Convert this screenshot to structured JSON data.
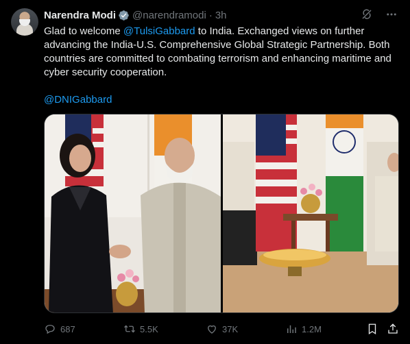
{
  "post": {
    "author_name": "Narendra Modi",
    "handle": "@narendramodi",
    "separator": "·",
    "time": "3h",
    "text_before": "Glad to welcome ",
    "mention": "@TulsiGabbard",
    "text_after": " to India. Exchanged views on further advancing the India-U.S. Comprehensive Global Strategic Partnership. Both countries are committed to combating terrorism and enhancing maritime and cyber security cooperation.",
    "tag": "@DNIGabbard"
  },
  "actions": {
    "replies": "687",
    "reposts": "5.5K",
    "likes": "37K",
    "views": "1.2M"
  },
  "colors": {
    "background": "#000000",
    "text": "#e7e9ea",
    "muted": "#71767b",
    "link": "#1d9bf0",
    "verified": "#829aab"
  },
  "icons": [
    "verified-badge-icon",
    "grok-icon",
    "more-icon",
    "reply-icon",
    "repost-icon",
    "like-icon",
    "views-icon",
    "bookmark-icon",
    "share-icon"
  ]
}
